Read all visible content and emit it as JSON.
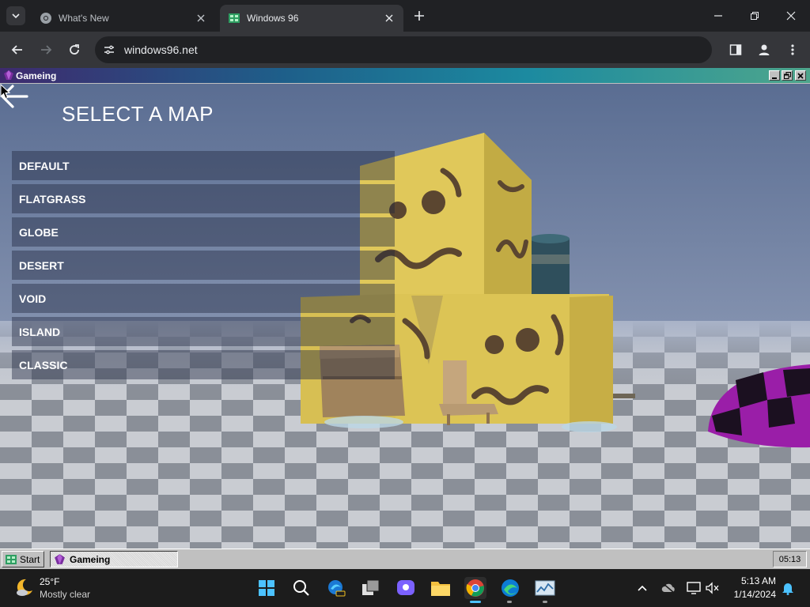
{
  "browser": {
    "tabs": [
      {
        "title": "What's New",
        "active": false
      },
      {
        "title": "Windows 96",
        "active": true
      }
    ],
    "url": "windows96.net",
    "accent": "#35363a"
  },
  "window": {
    "title": "Gameing"
  },
  "game": {
    "heading": "SELECT A MAP",
    "maps": [
      "DEFAULT",
      "FLATGRASS",
      "GLOBE",
      "DESERT",
      "VOID",
      "ISLAND",
      "CLASSIC"
    ]
  },
  "w96_taskbar": {
    "start_label": "Start",
    "task_label": "Gameing",
    "clock": "05:13"
  },
  "os_taskbar": {
    "weather_temp": "25°F",
    "weather_desc": "Mostly clear",
    "time": "5:13 AM",
    "date": "1/14/2024"
  },
  "icons": {
    "tab_search": "chevron-down-icon",
    "back": "back-arrow-icon",
    "forward": "forward-arrow-icon",
    "reload": "reload-icon",
    "site_info": "site-settings-icon",
    "bookmark": "star-icon",
    "side_panel": "side-panel-icon",
    "profile": "profile-icon",
    "menu": "kebab-menu-icon"
  }
}
